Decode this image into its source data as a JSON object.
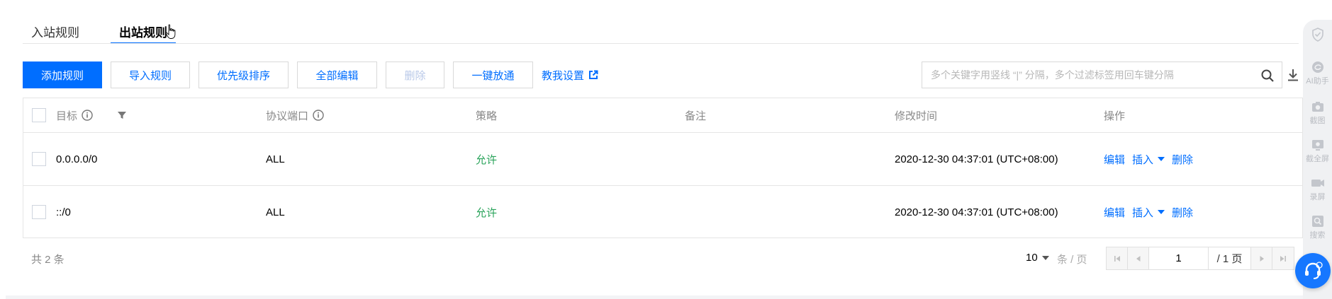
{
  "tabs": [
    {
      "label": "入站规则",
      "active": false
    },
    {
      "label": "出站规则",
      "active": true
    }
  ],
  "toolbar": {
    "add_label": "添加规则",
    "import_label": "导入规则",
    "priority_label": "优先级排序",
    "edit_all_label": "全部编辑",
    "delete_label": "删除",
    "allow_all_label": "一键放通",
    "tutorial_label": "教我设置"
  },
  "search": {
    "placeholder": "多个关键字用竖线 “|” 分隔，多个过滤标签用回车键分隔",
    "value": ""
  },
  "table": {
    "headers": {
      "target": "目标",
      "port": "协议端口",
      "policy": "策略",
      "remark": "备注",
      "modified": "修改时间",
      "ops": "操作"
    },
    "rows": [
      {
        "target": "0.0.0.0/0",
        "port": "ALL",
        "policy": "允许",
        "remark": "",
        "modified": "2020-12-30 04:37:01 (UTC+08:00)"
      },
      {
        "target": "::/0",
        "port": "ALL",
        "policy": "允许",
        "remark": "",
        "modified": "2020-12-30 04:37:01 (UTC+08:00)"
      }
    ],
    "ops": {
      "edit": "编辑",
      "insert": "插入",
      "delete": "删除"
    }
  },
  "footer": {
    "total": "共 2 条",
    "page_size": "10",
    "per_page": "条 / 页",
    "current_page": "1",
    "page_total": "/ 1 页"
  },
  "sidebar": {
    "items": [
      "AI助手",
      "截图",
      "截全屏",
      "录屏",
      "搜索"
    ]
  },
  "colors": {
    "primary": "#006eff",
    "allow": "#29a35a",
    "assistant": "#1677ff"
  }
}
